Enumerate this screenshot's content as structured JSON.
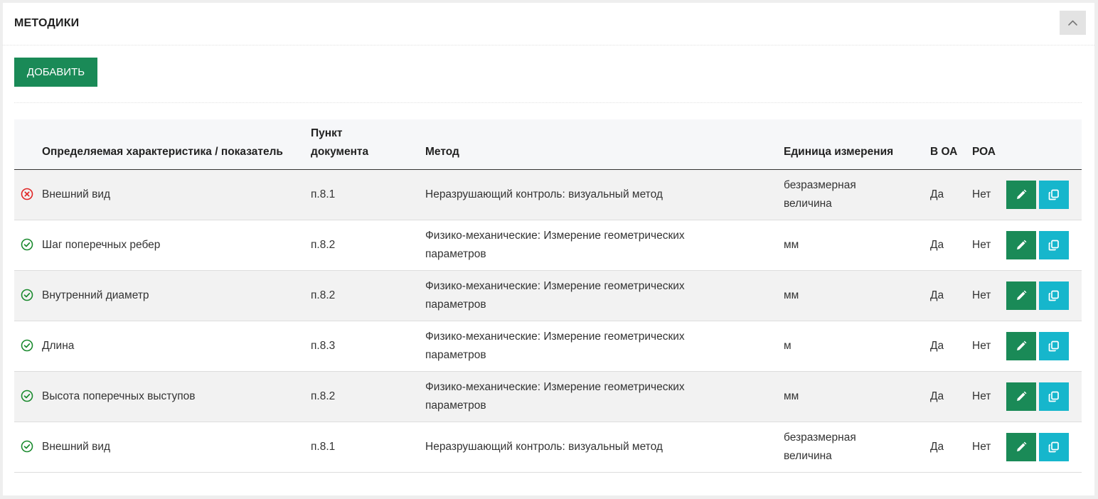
{
  "panel": {
    "title": "МЕТОДИКИ",
    "collapse_icon": "chevron-up-icon",
    "add_label": "ДОБАВИТЬ"
  },
  "colors": {
    "primary_green": "#1a8a57",
    "copy_cyan": "#16b6cc",
    "status_ok": "#1a8a2e",
    "status_error": "#e02424"
  },
  "table": {
    "headers": {
      "characteristic": "Определяемая характеристика / показатель",
      "clause": "Пункт документа",
      "method": "Метод",
      "unit": "Единица измерения",
      "in_oa": "В ОА",
      "roa": "РОА"
    },
    "rows": [
      {
        "status": "error",
        "status_icon": "x-circle-icon",
        "characteristic": "Внешний вид",
        "clause": "п.8.1",
        "method": "Неразрушающий контроль: визуальный метод",
        "unit": "безразмерная величина",
        "in_oa": "Да",
        "roa": "Нет"
      },
      {
        "status": "ok",
        "status_icon": "check-circle-icon",
        "characteristic": "Шаг поперечных ребер",
        "clause": "п.8.2",
        "method": "Физико-механические: Измерение геометрических параметров",
        "unit": "мм",
        "in_oa": "Да",
        "roa": "Нет"
      },
      {
        "status": "ok",
        "status_icon": "check-circle-icon",
        "characteristic": "Внутренний диаметр",
        "clause": "п.8.2",
        "method": "Физико-механические: Измерение геометрических параметров",
        "unit": "мм",
        "in_oa": "Да",
        "roa": "Нет"
      },
      {
        "status": "ok",
        "status_icon": "check-circle-icon",
        "characteristic": "Длина",
        "clause": "п.8.3",
        "method": "Физико-механические: Измерение геометрических параметров",
        "unit": "м",
        "in_oa": "Да",
        "roa": "Нет"
      },
      {
        "status": "ok",
        "status_icon": "check-circle-icon",
        "characteristic": "Высота поперечных выступов",
        "clause": "п.8.2",
        "method": "Физико-механические: Измерение геометрических параметров",
        "unit": "мм",
        "in_oa": "Да",
        "roa": "Нет"
      },
      {
        "status": "ok",
        "status_icon": "check-circle-icon",
        "characteristic": "Внешний вид",
        "clause": "п.8.1",
        "method": "Неразрушающий контроль: визуальный метод",
        "unit": "безразмерная величина",
        "in_oa": "Да",
        "roa": "Нет"
      }
    ]
  }
}
